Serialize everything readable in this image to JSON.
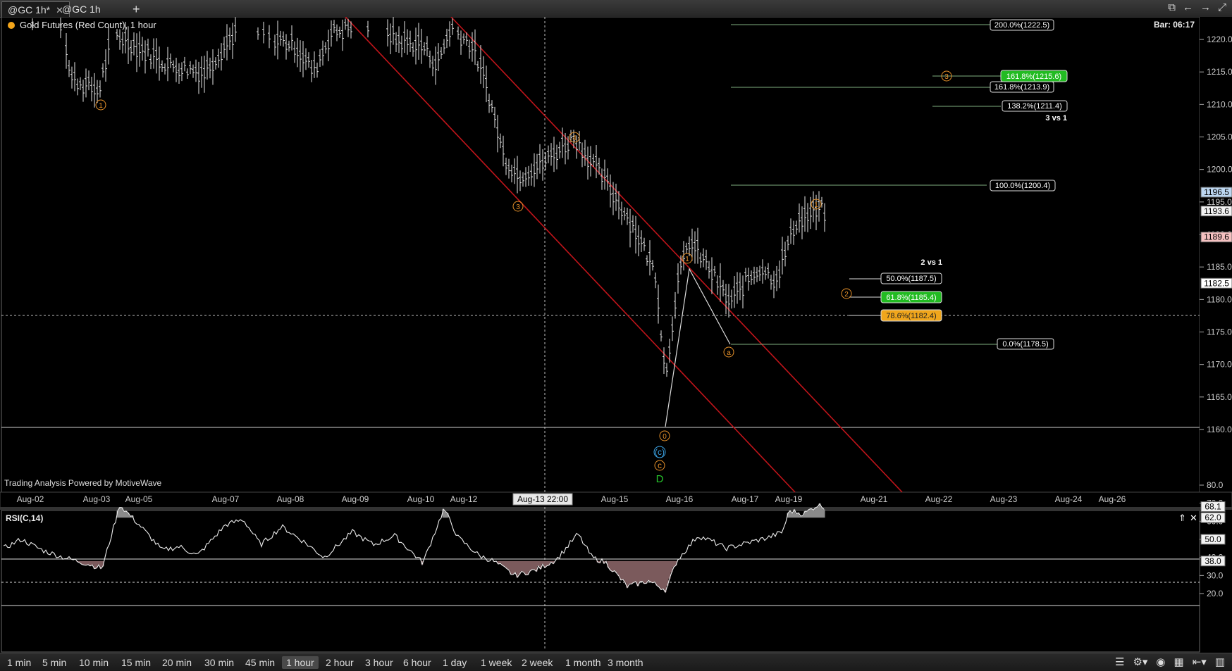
{
  "tabs": [
    {
      "label": "@GC 1h*",
      "active": true,
      "closable": true
    },
    {
      "label": "@GC 1h",
      "active": false,
      "closable": false
    }
  ],
  "add_tab_label": "+",
  "window_icons": [
    "popout-icon",
    "arrow-left-icon",
    "arrow-right-icon",
    "expand-icon"
  ],
  "chart_title": "Gold Futures (Red Count), 1 hour",
  "bar_timer": "Bar: 06:17",
  "watermark": "Trading Analysis Powered by MotiveWave",
  "crosshair_time": "Aug-13 22:00",
  "indicator_label": "RSI(C,14)",
  "x_labels": [
    "Aug-02",
    "Aug-03",
    "Aug-05",
    "Aug-07",
    "Aug-08",
    "Aug-09",
    "Aug-10",
    "Aug-12",
    "Aug-15",
    "Aug-16",
    "Aug-17",
    "Aug-19",
    "Aug-21",
    "Aug-22",
    "Aug-23",
    "Aug-24",
    "Aug-26"
  ],
  "price_ticks": [
    "1220.0",
    "1215.0",
    "1210.0",
    "1205.0",
    "1200.0",
    "1195.0",
    "1190.0",
    "1185.0",
    "1180.0",
    "1175.0",
    "1170.0",
    "1165.0",
    "1160.0"
  ],
  "price_markers": [
    {
      "label": "1196.5",
      "price": 1196.5,
      "color": "#bcd6f0"
    },
    {
      "label": "1193.6",
      "price": 1193.6,
      "color": "#f2f2f2"
    },
    {
      "label": "1189.6",
      "price": 1189.6,
      "color": "#f4c0c0"
    },
    {
      "label": "1182.5",
      "price": 1182.5,
      "color": "#ffffff"
    }
  ],
  "rsi_ticks": [
    "80.0",
    "70.0",
    "60.0",
    "50.0",
    "40.0",
    "30.0",
    "20.0"
  ],
  "rsi_markers": [
    {
      "label": "68.1",
      "value": 68.1
    },
    {
      "label": "62.0",
      "value": 62.0
    },
    {
      "label": "50.0",
      "value": 50.0
    },
    {
      "label": "38.0",
      "value": 38.0
    }
  ],
  "fib_labels": [
    {
      "label": "200.0%(1222.5)",
      "price": 1222.5,
      "style": "plain"
    },
    {
      "label": "161.8%(1215.6)",
      "price": 1215.6,
      "style": "green"
    },
    {
      "label": "161.8%(1213.9)",
      "price": 1213.9,
      "style": "plain"
    },
    {
      "label": "138.2%(1211.4)",
      "price": 1211.4,
      "style": "plain"
    },
    {
      "label": "100.0%(1200.4)",
      "price": 1200.4,
      "style": "plain"
    },
    {
      "label": "50.0%(1187.5)",
      "price": 1187.5,
      "style": "plain"
    },
    {
      "label": "61.8%(1185.4)",
      "price": 1185.4,
      "style": "green"
    },
    {
      "label": "78.6%(1182.4)",
      "price": 1182.4,
      "style": "orange"
    },
    {
      "label": "0.0%(1178.5)",
      "price": 1178.5,
      "style": "plain"
    }
  ],
  "fib_group_titles": [
    "3 vs 1",
    "2 vs 1"
  ],
  "wave_labels": [
    "1",
    "3",
    "4",
    "0",
    "1",
    "a",
    "1",
    "2",
    "3"
  ],
  "wave_labels_big": [
    "(c)",
    "c",
    "D"
  ],
  "colors": {
    "channel": "#c0141a",
    "wave_orange": "#e8922a",
    "wave_blue": "#3aa0e0",
    "wave_green": "#27c42c",
    "rsi_fill": "#7b5a5c",
    "rsi_fill_up": "#8a8a8a"
  },
  "timeframes": [
    "1 min",
    "5 min",
    "10 min",
    "15 min",
    "20 min",
    "30 min",
    "45 min",
    "1 hour",
    "2 hour",
    "3 hour",
    "6 hour",
    "1 day",
    "1 week",
    "2 week",
    "1 month",
    "3 month"
  ],
  "selected_timeframe": "1 hour",
  "bottom_tool_icons": [
    "list-icon",
    "chart-settings-icon",
    "eye-icon",
    "grid-icon",
    "zoom-icon",
    "bar-chart-icon"
  ]
}
